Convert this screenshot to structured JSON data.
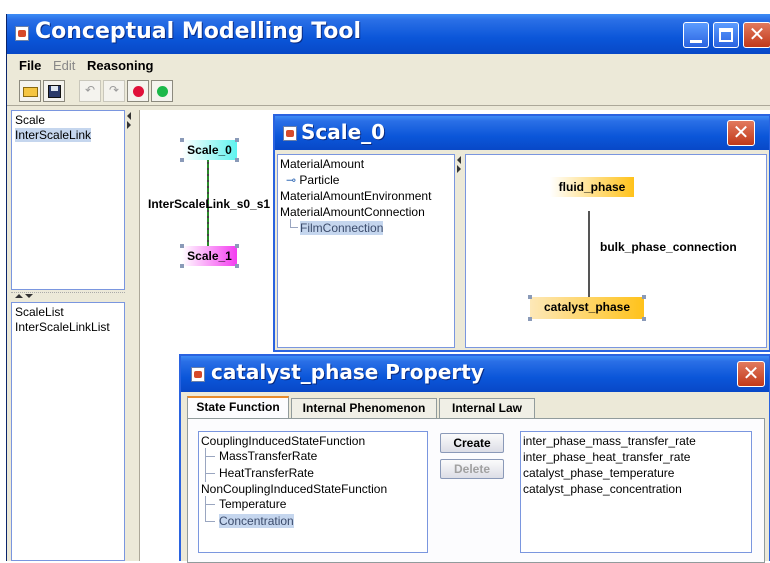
{
  "app": {
    "title": "Conceptual Modelling Tool",
    "menus": [
      "File",
      "Edit",
      "Reasoning"
    ]
  },
  "toolbar": {
    "buttons": [
      {
        "icon": "folder-open-icon",
        "enabled": true
      },
      {
        "icon": "save-icon",
        "enabled": true
      },
      {
        "icon": "undo-icon",
        "enabled": false
      },
      {
        "icon": "redo-icon",
        "enabled": false
      },
      {
        "icon": "red-circle-icon",
        "enabled": true
      },
      {
        "icon": "green-circle-icon",
        "enabled": true
      }
    ]
  },
  "left_top": {
    "items": [
      "Scale",
      "InterScaleLink"
    ],
    "selected": 1
  },
  "left_bottom": {
    "items": [
      "ScaleList",
      "InterScaleLinkList"
    ]
  },
  "main_graph": {
    "nodes": [
      "Scale_0",
      "Scale_1"
    ],
    "edge_label": "InterScaleLink_s0_s1"
  },
  "scale_window": {
    "title": "Scale_0",
    "tree": [
      "MaterialAmount",
      "Particle",
      "MaterialAmountEnvironment",
      "MaterialAmountConnection",
      "FilmConnection"
    ],
    "graph": {
      "nodes": [
        "fluid_phase",
        "catalyst_phase"
      ],
      "edge_label": "bulk_phase_connection"
    }
  },
  "property_window": {
    "title": "catalyst_phase Property",
    "tabs": [
      "State Function",
      "Internal Phenomenon",
      "Internal Law"
    ],
    "active_tab": 0,
    "tree": [
      "CouplingInducedStateFunction",
      "MassTransferRate",
      "HeatTransferRate",
      "NonCouplingInducedStateFunction",
      "Temperature",
      "Concentration"
    ],
    "buttons": {
      "create": "Create",
      "delete": "Delete"
    },
    "list": [
      "inter_phase_mass_transfer_rate",
      "inter_phase_heat_transfer_rate",
      "catalyst_phase_temperature",
      "catalyst_phase_concentration"
    ]
  },
  "colors": {
    "titlebar": "#0b56d9",
    "node_cyan": "#5ff3ef",
    "node_magenta": "#f43cf0",
    "node_orange": "#ffc21a",
    "node_peach": "#fde8b8",
    "selection": "#c5d6ee"
  }
}
